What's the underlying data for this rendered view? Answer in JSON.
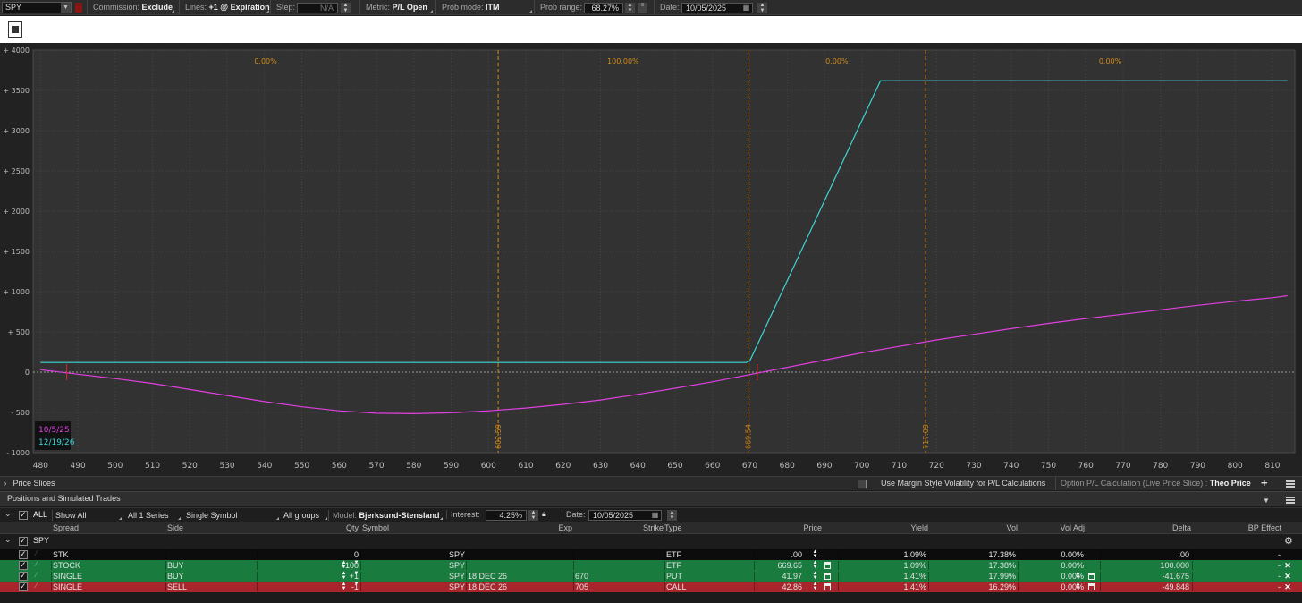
{
  "toolbar": {
    "symbol": "SPY",
    "commission_label": "Commission:",
    "commission_value": "Exclude",
    "lines_label": "Lines:",
    "lines_value": "+1 @ Expiration",
    "step_label": "Step:",
    "step_value": "N/A",
    "metric_label": "Metric:",
    "metric_value": "P/L Open",
    "prob_mode_label": "Prob mode:",
    "prob_mode_value": "ITM",
    "prob_range_label": "Prob range:",
    "prob_range_value": "68.27%",
    "date_label": "Date:",
    "date_value": "10/05/2025"
  },
  "chart_data": {
    "type": "line",
    "xlim": [
      478,
      816
    ],
    "ylim": [
      -1000,
      4000
    ],
    "x_ticks": [
      "480",
      "490",
      "500",
      "510",
      "520",
      "530",
      "540",
      "550",
      "560",
      "570",
      "580",
      "590",
      "600",
      "610",
      "620",
      "630",
      "640",
      "650",
      "660",
      "670",
      "680",
      "690",
      "700",
      "710",
      "720",
      "730",
      "740",
      "750",
      "760",
      "770",
      "780",
      "790",
      "800",
      "810"
    ],
    "y_ticks": [
      "+ 4000",
      "+ 3500",
      "+ 3000",
      "+ 2500",
      "+ 2000",
      "+ 1500",
      "+ 1000",
      "+ 500",
      "0",
      "- 500",
      "- 1000"
    ],
    "grid": true,
    "legend_position": "bottom-left",
    "series": [
      {
        "name": "10/5/25",
        "color": "#e040e0",
        "x": [
          480,
          490,
          500,
          510,
          520,
          530,
          540,
          550,
          560,
          570,
          580,
          590,
          600,
          610,
          620,
          630,
          640,
          650,
          660,
          670,
          680,
          690,
          700,
          710,
          720,
          730,
          740,
          750,
          760,
          770,
          780,
          790,
          800,
          810,
          814
        ],
        "y": [
          30,
          -25,
          -80,
          -140,
          -215,
          -290,
          -365,
          -430,
          -480,
          -510,
          -515,
          -505,
          -480,
          -445,
          -400,
          -345,
          -275,
          -200,
          -120,
          -30,
          60,
          150,
          240,
          320,
          400,
          470,
          540,
          605,
          665,
          720,
          775,
          830,
          880,
          925,
          950
        ]
      },
      {
        "name": "12/19/26",
        "color": "#3ed6d6",
        "x": [
          480,
          669,
          670,
          705,
          814
        ],
        "y": [
          120,
          120,
          140,
          3620,
          3620
        ]
      }
    ],
    "vlines": [
      {
        "x": 602.59,
        "label": "602.59"
      },
      {
        "x": 669.54,
        "label": "669.54"
      },
      {
        "x": 717.09,
        "label": "717.09"
      }
    ],
    "region_probs": [
      {
        "from": 478,
        "to": 602.59,
        "label": "0.00%"
      },
      {
        "from": 602.59,
        "to": 669.54,
        "label": "100.00%"
      },
      {
        "from": 669.54,
        "to": 717.09,
        "label": "0.00%"
      },
      {
        "from": 717.09,
        "to": 816,
        "label": "0.00%"
      }
    ],
    "breakevens": [
      487,
      672
    ]
  },
  "price_slices": {
    "title": "Price Slices",
    "margin_label": "Use Margin Style Volatility for P/L Calculations",
    "calc_label": "Option P/L Calculation (Live Price Slice) :",
    "calc_value": "Theo Price"
  },
  "positions": {
    "title": "Positions and Simulated Trades",
    "all_label": "ALL",
    "show_all": "Show All",
    "series": "All 1 Series",
    "symbol_mode": "Single Symbol",
    "groups": "All groups",
    "model_label": "Model:",
    "model_value": "Bjerksund-Stensland",
    "interest_label": "Interest:",
    "interest_value": "4.25%",
    "date_label": "Date:",
    "date_value": "10/05/2025",
    "headers": {
      "spread": "Spread",
      "side": "Side",
      "qty": "Qty",
      "symbol": "Symbol",
      "exp": "Exp",
      "strike": "Strike",
      "type": "Type",
      "price": "Price",
      "yield": "Yield",
      "vol": "Vol",
      "vol_adj": "Vol Adj",
      "delta": "Delta",
      "bp_effect": "BP Effect"
    },
    "group_name": "SPY",
    "rows": [
      {
        "spread": "STK",
        "side": "",
        "qty": "0",
        "symbol": "SPY",
        "exp": "",
        "strike": "",
        "type": "ETF",
        "price": ".00",
        "yield": "1.09%",
        "vol": "17.38%",
        "vol_adj": "0.00%",
        "delta": ".00",
        "bp": "-",
        "color": "#0c0c0c"
      },
      {
        "spread": "STOCK",
        "side": "BUY",
        "qty": "+100",
        "symbol": "SPY",
        "exp": "",
        "strike": "",
        "type": "ETF",
        "price": "669.65",
        "yield": "1.09%",
        "vol": "17.38%",
        "vol_adj": "0.00%",
        "delta": "100.000",
        "bp": "-",
        "color": "#197b3e"
      },
      {
        "spread": "SINGLE",
        "side": "BUY",
        "qty": "+1",
        "symbol": "SPY",
        "exp": "18 DEC 26",
        "strike": "670",
        "type": "PUT",
        "price": "41.97",
        "yield": "1.41%",
        "vol": "17.99%",
        "vol_adj": "0.00%",
        "delta": "-41.675",
        "bp": "-",
        "color": "#197b3e"
      },
      {
        "spread": "SINGLE",
        "side": "SELL",
        "qty": "-1",
        "symbol": "SPY",
        "exp": "18 DEC 26",
        "strike": "705",
        "type": "CALL",
        "price": "42.86",
        "yield": "1.41%",
        "vol": "16.29%",
        "vol_adj": "0.00%",
        "delta": "-49.848",
        "bp": "-",
        "color": "#a8252c"
      }
    ]
  }
}
